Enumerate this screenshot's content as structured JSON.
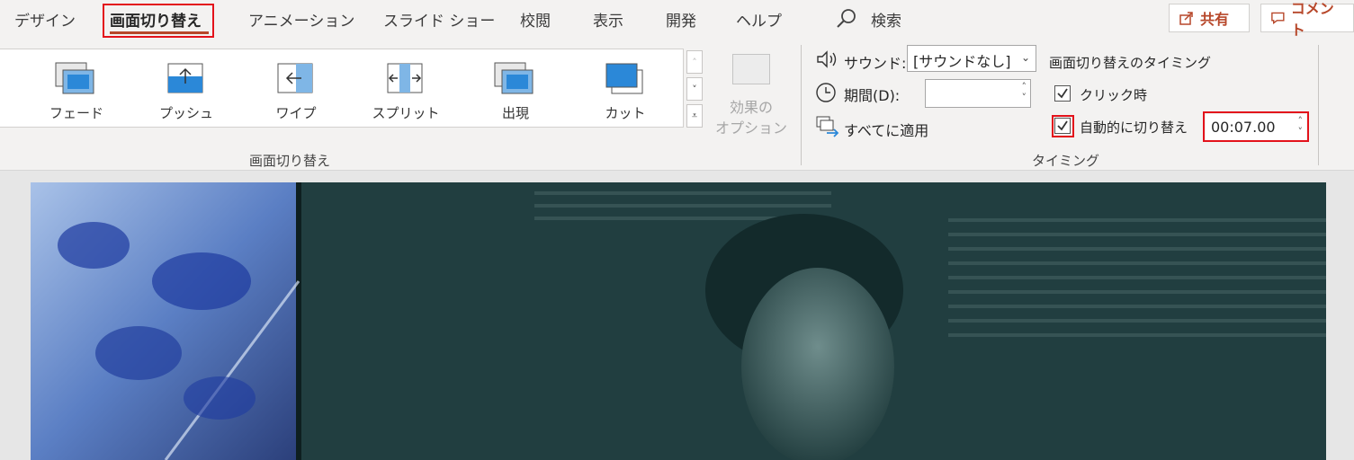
{
  "tabs": [
    {
      "label": "デザイン"
    },
    {
      "label": "画面切り替え"
    },
    {
      "label": "アニメーション"
    },
    {
      "label": "スライド ショー"
    },
    {
      "label": "校閲"
    },
    {
      "label": "表示"
    },
    {
      "label": "開発"
    },
    {
      "label": "ヘルプ"
    }
  ],
  "search": {
    "label": "検索",
    "icon": "search-icon"
  },
  "share": {
    "label": "共有"
  },
  "comment": {
    "label": "コメント"
  },
  "transitions": {
    "items": [
      {
        "label": "フェード",
        "icon": "fade-icon"
      },
      {
        "label": "プッシュ",
        "icon": "push-icon"
      },
      {
        "label": "ワイプ",
        "icon": "wipe-icon"
      },
      {
        "label": "スプリット",
        "icon": "split-icon"
      },
      {
        "label": "出現",
        "icon": "reveal-icon"
      },
      {
        "label": "カット",
        "icon": "cut-icon"
      }
    ],
    "group_label": "画面切り替え"
  },
  "effect_options": {
    "line1": "効果の",
    "line2": "オプション"
  },
  "timing": {
    "sound_label": "サウンド:",
    "sound_value": "[サウンドなし]",
    "duration_label": "期間(D):",
    "duration_value": "",
    "apply_all_label": "すべてに適用",
    "advance_title": "画面切り替えのタイミング",
    "on_click_label": "クリック時",
    "on_click_checked": true,
    "after_label": "自動的に切り替え",
    "after_checked": true,
    "after_value": "00:07.00",
    "group_label": "タイミング"
  },
  "colors": {
    "accent": "#b7472a",
    "highlight": "#e3121b",
    "icon_blue": "#2b88d8"
  }
}
